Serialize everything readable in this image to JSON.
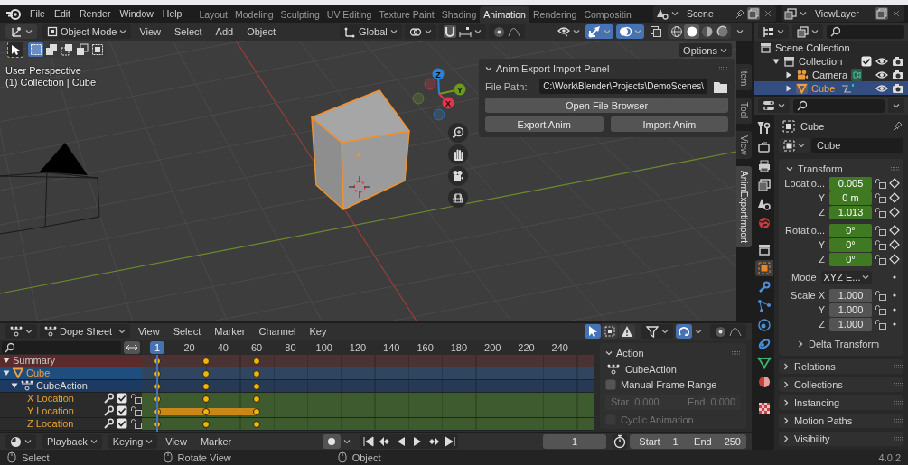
{
  "topbar": {
    "menus": [
      "File",
      "Edit",
      "Render",
      "Window",
      "Help"
    ],
    "workspaces": [
      {
        "label": "Layout",
        "selected": false
      },
      {
        "label": "Modeling",
        "selected": false
      },
      {
        "label": "Sculpting",
        "selected": false
      },
      {
        "label": "UV Editing",
        "selected": false
      },
      {
        "label": "Texture Paint",
        "selected": false
      },
      {
        "label": "Shading",
        "selected": false
      },
      {
        "label": "Animation",
        "selected": true
      },
      {
        "label": "Rendering",
        "selected": false
      },
      {
        "label": "Compositin",
        "selected": false
      }
    ],
    "scene": "Scene",
    "view_layer": "ViewLayer"
  },
  "viewport": {
    "mode": "Object Mode",
    "menus": [
      "View",
      "Select",
      "Add",
      "Object"
    ],
    "orientation": "Global",
    "select_modes": [
      {
        "kind": "set",
        "selected": true
      },
      {
        "kind": "extend",
        "selected": false
      },
      {
        "kind": "subtract",
        "selected": false
      },
      {
        "kind": "invert",
        "selected": false
      },
      {
        "kind": "intersect",
        "selected": false
      }
    ],
    "toggles": [
      {
        "kind": "gizmos",
        "on": true
      },
      {
        "kind": "overlays",
        "on": true
      },
      {
        "kind": "xray",
        "on": false
      }
    ],
    "shading": [
      {
        "kind": "wireframe",
        "selected": false
      },
      {
        "kind": "solid",
        "selected": true
      },
      {
        "kind": "material",
        "selected": false
      },
      {
        "kind": "rendered",
        "selected": false
      }
    ],
    "options": "Options",
    "info": [
      "User Perspective",
      "(1) Collection | Cube"
    ],
    "axes": [
      "Z",
      "Y",
      "X"
    ],
    "panel": {
      "title": "Anim Export Import Panel",
      "expanded": true,
      "path_label": "File Path:",
      "path": "C:\\Work\\Blender\\Projects\\DemoScenes\\",
      "browse": "Open File Browser",
      "actions": [
        "Export Anim",
        "Import Anim"
      ]
    },
    "side_tabs": [
      {
        "label": "Item",
        "selected": false
      },
      {
        "label": "Tool",
        "selected": false
      },
      {
        "label": "View",
        "selected": false
      },
      {
        "label": "AnimExportImport",
        "selected": true
      }
    ]
  },
  "dopesheet": {
    "mode": "Dope Sheet",
    "menus": [
      "View",
      "Select",
      "Marker",
      "Channel",
      "Key"
    ],
    "toggles": [
      {
        "kind": "only-selected",
        "on": true
      },
      {
        "kind": "hidden",
        "on": false
      },
      {
        "kind": "errors",
        "on": false
      }
    ],
    "snapping": true,
    "current_frame": "1",
    "ticks": [
      "20",
      "40",
      "60",
      "80",
      "100",
      "120",
      "140",
      "160",
      "180",
      "200",
      "220",
      "240"
    ],
    "channels": [
      {
        "label": "Summary",
        "kind": "summary",
        "expanded": true
      },
      {
        "label": "Cube",
        "kind": "object",
        "expanded": true
      },
      {
        "label": "CubeAction",
        "kind": "action",
        "expanded": true
      },
      {
        "label": "X Location",
        "kind": "fcurve",
        "checked": true,
        "hold": false
      },
      {
        "label": "Y Location",
        "kind": "fcurve",
        "checked": true,
        "hold": true
      },
      {
        "label": "Z Location",
        "kind": "fcurve",
        "checked": true,
        "hold": false
      }
    ],
    "action_panel": {
      "title": "Action",
      "expanded": true,
      "action": "CubeAction",
      "manual_range": {
        "label": "Manual Frame Range",
        "checked": false
      },
      "start_label": "Star",
      "start": "0.000",
      "end_label": "End",
      "end": "0.000",
      "range_disabled": true,
      "cyclic": {
        "label": "Cyclic Animation",
        "checked": false,
        "disabled": true
      }
    }
  },
  "timeline": {
    "menus": [
      "Playback",
      "Keying",
      "View",
      "Marker"
    ],
    "auto_key": false,
    "frame": "1",
    "start_label": "Start",
    "start": "1",
    "end_label": "End",
    "end": "250"
  },
  "outliner": {
    "items": [
      {
        "label": "Scene Collection",
        "kind": "scene",
        "selected": false,
        "children": [
          {
            "label": "Collection",
            "kind": "collection",
            "selected": false,
            "expanded": true,
            "checked": true,
            "children": [
              {
                "label": "Camera",
                "kind": "camera",
                "selected": false,
                "expanded": false
              },
              {
                "label": "Cube",
                "kind": "mesh",
                "selected": true,
                "expanded": false
              }
            ]
          }
        ]
      }
    ]
  },
  "properties": {
    "tabs": [
      {
        "kind": "tool",
        "selected": false
      },
      {
        "kind": "render",
        "selected": false
      },
      {
        "kind": "output",
        "selected": false
      },
      {
        "kind": "view-layer",
        "selected": false
      },
      {
        "kind": "scene",
        "selected": false
      },
      {
        "kind": "world",
        "selected": false
      },
      {
        "kind": "collection",
        "selected": false
      },
      {
        "kind": "object",
        "selected": true
      },
      {
        "kind": "modifiers",
        "selected": false
      },
      {
        "kind": "particles",
        "selected": false
      },
      {
        "kind": "physics",
        "selected": false
      },
      {
        "kind": "constraints",
        "selected": false
      },
      {
        "kind": "data",
        "selected": false
      },
      {
        "kind": "material",
        "selected": false
      },
      {
        "kind": "texture",
        "selected": false
      }
    ],
    "object": "Cube",
    "datablock": "Cube",
    "transform": {
      "title": "Transform",
      "expanded": true,
      "groups": [
        {
          "fields": [
            {
              "label": "Locatio...",
              "value": "0.005",
              "kind": "number",
              "animated": true
            },
            {
              "label": "Y",
              "value": "0 m",
              "kind": "number",
              "animated": true
            },
            {
              "label": "Z",
              "value": "1.013",
              "kind": "number",
              "animated": true
            }
          ]
        },
        {
          "fields": [
            {
              "label": "Rotatio...",
              "value": "0°",
              "kind": "number",
              "animated": true
            },
            {
              "label": "Y",
              "value": "0°",
              "kind": "number",
              "animated": true
            },
            {
              "label": "Z",
              "value": "0°",
              "kind": "number",
              "animated": true
            }
          ]
        },
        {
          "fields": [
            {
              "label": "Mode",
              "value": "XYZ E...",
              "kind": "dropdown"
            }
          ]
        },
        {
          "fields": [
            {
              "label": "Scale X",
              "value": "1.000",
              "kind": "number",
              "animated": false
            },
            {
              "label": "Y",
              "value": "1.000",
              "kind": "number",
              "animated": false
            },
            {
              "label": "Z",
              "value": "1.000",
              "kind": "number",
              "animated": false
            }
          ]
        }
      ],
      "subpanels": [
        {
          "title": "Delta Transform",
          "expanded": false
        }
      ]
    },
    "panels": [
      {
        "title": "Relations",
        "expanded": false
      },
      {
        "title": "Collections",
        "expanded": false
      },
      {
        "title": "Instancing",
        "expanded": false
      },
      {
        "title": "Motion Paths",
        "expanded": false
      },
      {
        "title": "Visibility",
        "expanded": false
      }
    ]
  },
  "status_bar": {
    "hints": [
      "Select",
      "Rotate View",
      "Object"
    ],
    "version": "4.0.2"
  }
}
